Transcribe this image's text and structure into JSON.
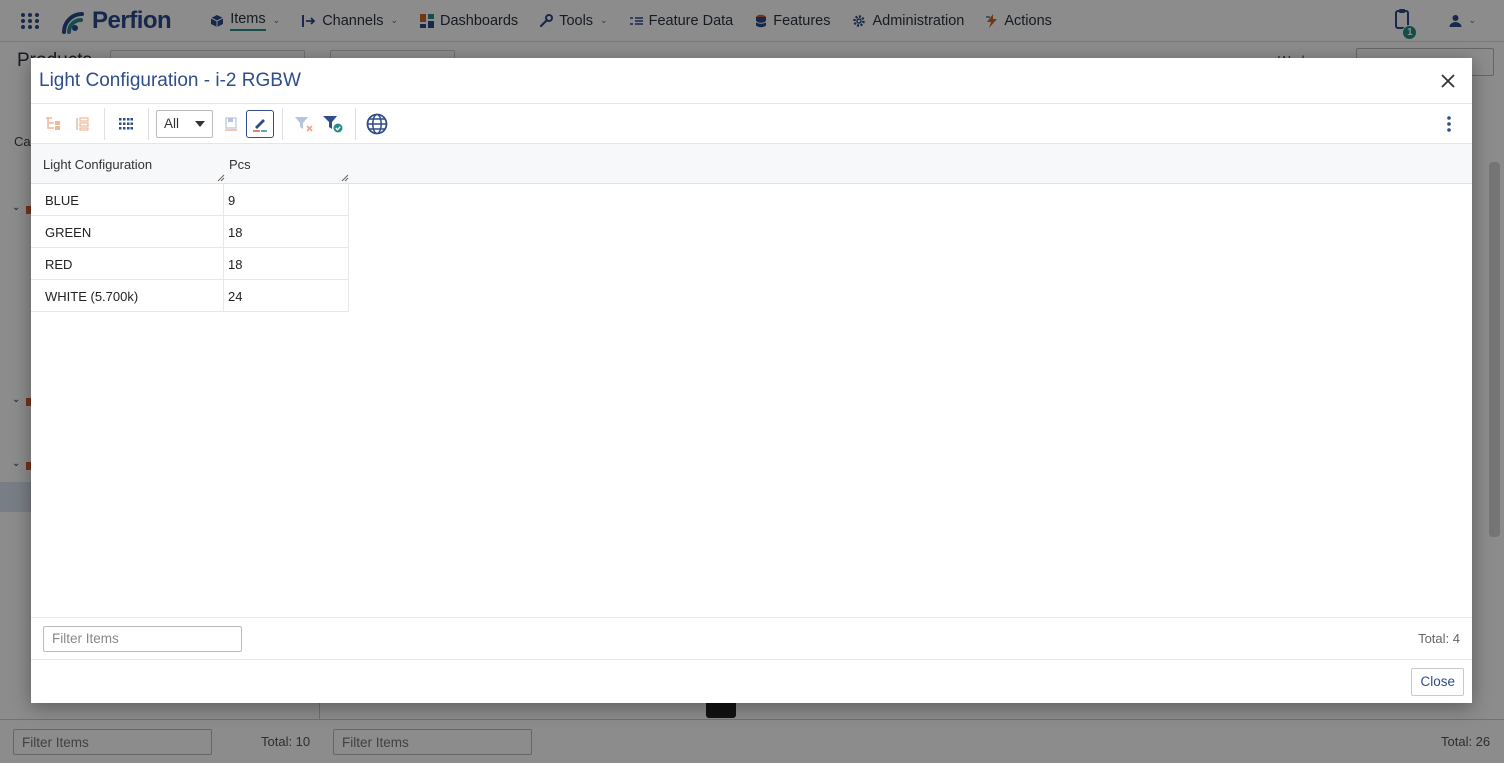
{
  "app": {
    "brand": "Perfion",
    "nav": [
      {
        "label": "Items",
        "has_menu": true,
        "active": true,
        "icon": "cube-icon"
      },
      {
        "label": "Channels",
        "has_menu": true,
        "icon": "channel-arrow-icon"
      },
      {
        "label": "Dashboards",
        "icon": "dashboard-tiles-icon"
      },
      {
        "label": "Tools",
        "has_menu": true,
        "icon": "wrench-icon"
      },
      {
        "label": "Feature Data",
        "icon": "list-lines-icon"
      },
      {
        "label": "Features",
        "icon": "database-icon"
      },
      {
        "label": "Administration",
        "icon": "gear-icon"
      },
      {
        "label": "Actions",
        "icon": "lightning-icon"
      }
    ],
    "notification_count": "1"
  },
  "background": {
    "title": "Products",
    "section_label": "Ca",
    "workbench_label": "Workspace:",
    "left_filter_placeholder": "Filter Items",
    "left_total": "Total: 10",
    "right_filter_placeholder": "Filter Items",
    "right_total": "Total: 26"
  },
  "modal": {
    "title": "Light Configuration - i-2 RGBW",
    "toolbar": {
      "view_select_value": "All"
    },
    "columns": [
      "Light Configuration",
      "Pcs"
    ],
    "rows": [
      {
        "name": "BLUE",
        "pcs": "9"
      },
      {
        "name": "GREEN",
        "pcs": "18"
      },
      {
        "name": "RED",
        "pcs": "18"
      },
      {
        "name": "WHITE (5.700k)",
        "pcs": "24"
      }
    ],
    "filter_placeholder": "Filter Items",
    "total": "Total: 4",
    "close_label": "Close"
  },
  "colors": {
    "brand": "#2a4a8a",
    "accent": "#2a8b8c",
    "title": "#2f4d8a",
    "badge": "#1f8e83"
  }
}
